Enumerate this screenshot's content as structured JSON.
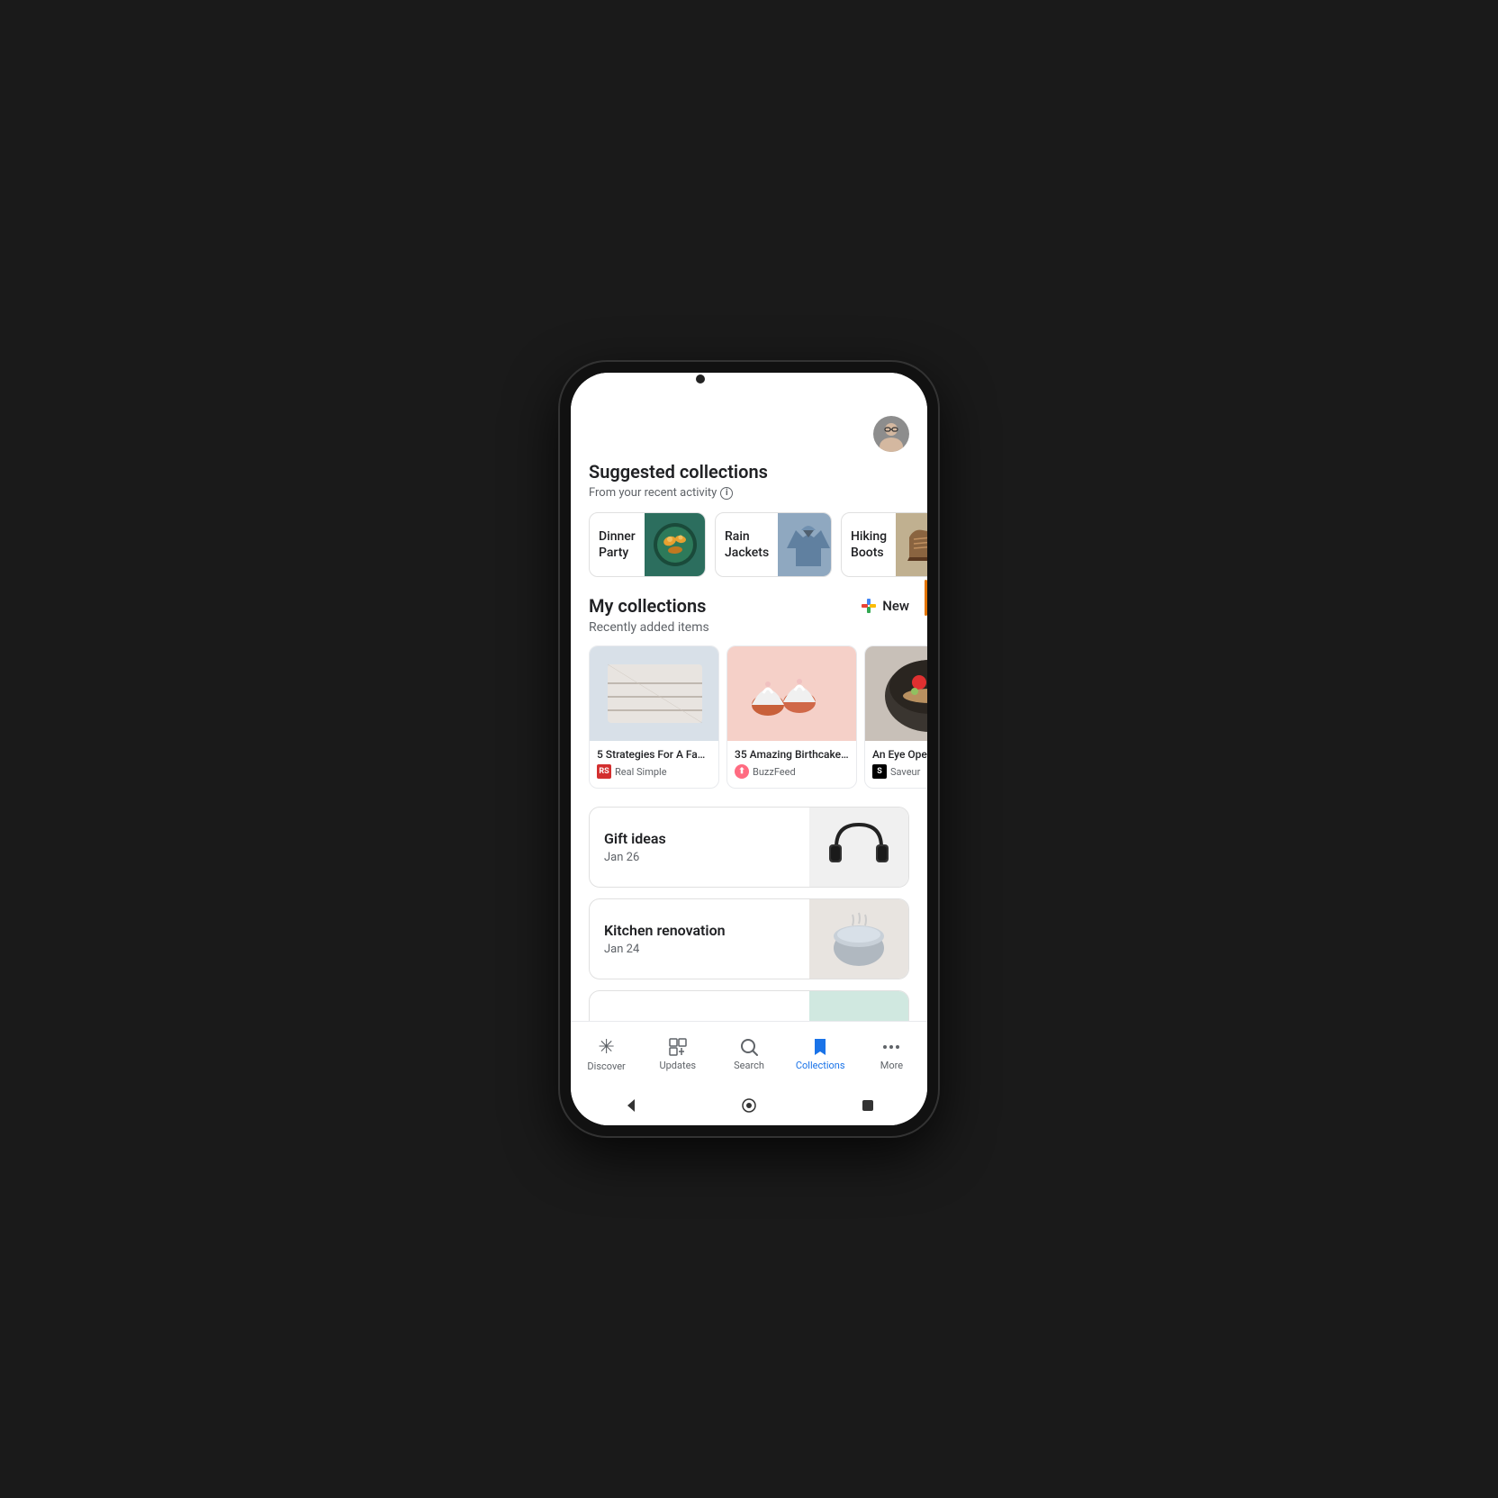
{
  "phone": {
    "suggested": {
      "title": "Suggested collections",
      "subtitle": "From your recent activity",
      "chips": [
        {
          "label": "Dinner Party",
          "color": "#f0e68c"
        },
        {
          "label": "Rain Jackets",
          "color": "#b0c4de"
        },
        {
          "label": "Hiking Boots",
          "color": "#c0c0c0"
        }
      ]
    },
    "myCollections": {
      "title": "My collections",
      "newLabel": "New",
      "recentlyLabel": "Recently added items",
      "items": [
        {
          "title": "5 Strategies For A Fab...",
          "source": "Real Simple",
          "sourceBadge": "RS",
          "badgeType": "rs"
        },
        {
          "title": "35 Amazing Birthcake...",
          "source": "BuzzFeed",
          "sourceBadge": "B",
          "badgeType": "bf"
        },
        {
          "title": "An Eye Openin...",
          "source": "Saveur",
          "sourceBadge": "S",
          "badgeType": "saveur"
        }
      ]
    },
    "collections": [
      {
        "name": "Gift ideas",
        "date": "Jan 26"
      },
      {
        "name": "Kitchen renovation",
        "date": "Jan 24"
      }
    ],
    "bottomNav": [
      {
        "label": "Discover",
        "icon": "✳",
        "active": false
      },
      {
        "label": "Updates",
        "icon": "⬆",
        "active": false
      },
      {
        "label": "Search",
        "icon": "🔍",
        "active": false
      },
      {
        "label": "Collections",
        "icon": "🔖",
        "active": true
      },
      {
        "label": "More",
        "icon": "•••",
        "active": false
      }
    ]
  }
}
